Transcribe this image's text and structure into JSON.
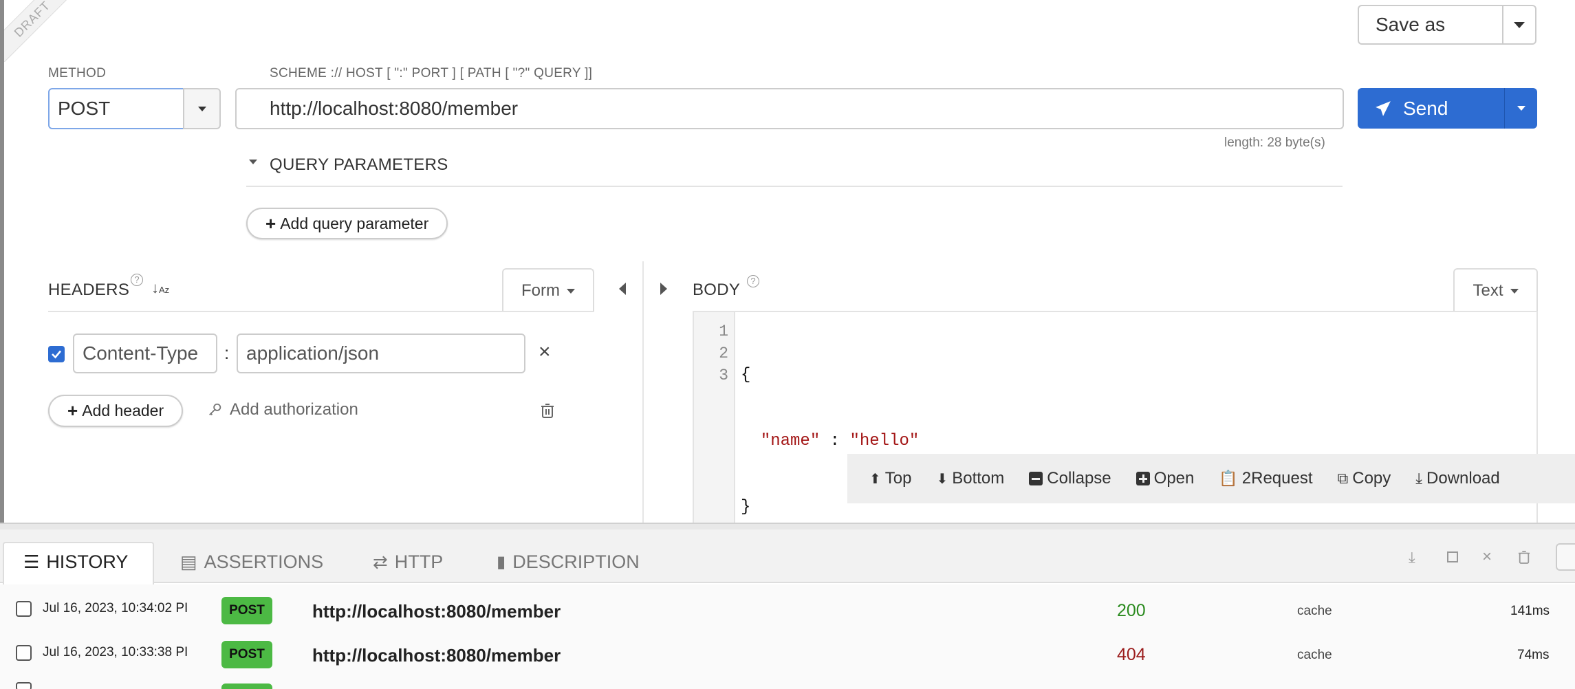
{
  "ribbon": {
    "text": "DRAFT"
  },
  "toolbar": {
    "save_as_label": "Save as",
    "send_label": "Send"
  },
  "method": {
    "label": "METHOD",
    "value": "POST"
  },
  "url": {
    "label": "SCHEME :// HOST [ \":\" PORT ] [ PATH [ \"?\" QUERY ]]",
    "value": "http://localhost:8080/member",
    "length_text": "length: 28 byte(s)"
  },
  "query": {
    "title": "QUERY PARAMETERS",
    "add_label": "Add query parameter"
  },
  "headers": {
    "title": "HEADERS",
    "form_label": "Form",
    "items": [
      {
        "checked": true,
        "name": "Content-Type",
        "separator": ":",
        "value": "application/json"
      }
    ],
    "add_header_label": "Add header",
    "add_auth_label": "Add authorization"
  },
  "body": {
    "title": "BODY",
    "mode_label": "Text",
    "lines": [
      {
        "num": "1",
        "text": "{"
      },
      {
        "num": "2",
        "key": "\"name\"",
        "sep": " : ",
        "val": "\"hello\""
      },
      {
        "num": "3",
        "text": "}"
      }
    ],
    "actions": {
      "top": "Top",
      "bottom": "Bottom",
      "collapse": "Collapse",
      "open": "Open",
      "to_request": "2Request",
      "copy": "Copy",
      "download": "Download"
    }
  },
  "bottom_tabs": [
    {
      "label": "HISTORY",
      "active": true
    },
    {
      "label": "ASSERTIONS",
      "active": false
    },
    {
      "label": "HTTP",
      "active": false
    },
    {
      "label": "DESCRIPTION",
      "active": false
    }
  ],
  "history": [
    {
      "date": "Jul 16, 2023, 10:34:02 PI",
      "method": "POST",
      "url": "http://localhost:8080/member",
      "status": "200",
      "source": "cache",
      "time": "141ms"
    },
    {
      "date": "Jul 16, 2023, 10:33:38 PI",
      "method": "POST",
      "url": "http://localhost:8080/member",
      "status": "404",
      "source": "cache",
      "time": "74ms"
    }
  ],
  "colors": {
    "send": "#2d6cd2",
    "post_badge": "#4cb944",
    "status_ok": "#2a8a1e",
    "status_err": "#9b1c1c",
    "json_string": "#a31515",
    "checkbox_checked": "#2d6cd2"
  }
}
